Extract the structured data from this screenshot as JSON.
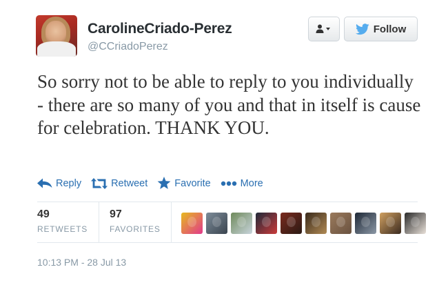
{
  "user": {
    "display_name": "CarolineCriado-Perez",
    "handle": "@CCriadoPerez"
  },
  "buttons": {
    "follow_label": "Follow"
  },
  "tweet": {
    "text": "So sorry not to be able to reply to you individually - there are so many of you and that in itself is cause for celebration. THANK YOU."
  },
  "actions": {
    "reply": "Reply",
    "retweet": "Retweet",
    "favorite": "Favorite",
    "more": "More"
  },
  "stats": {
    "retweets_count": "49",
    "retweets_label": "RETWEETS",
    "favorites_count": "97",
    "favorites_label": "FAVORITES"
  },
  "favoriters": [
    {
      "name": "favoriter-avatar-1",
      "colors": [
        "#e6b81f",
        "#e13a8c"
      ]
    },
    {
      "name": "favoriter-avatar-2",
      "colors": [
        "#7c8b98",
        "#3b4550"
      ]
    },
    {
      "name": "favoriter-avatar-3",
      "colors": [
        "#6f8a5b",
        "#c8d4dc"
      ]
    },
    {
      "name": "favoriter-avatar-4",
      "colors": [
        "#1f2a3a",
        "#c93a3a"
      ]
    },
    {
      "name": "favoriter-avatar-5",
      "colors": [
        "#7a2a1e",
        "#2b1a14"
      ]
    },
    {
      "name": "favoriter-avatar-6",
      "colors": [
        "#3a2a1c",
        "#b08a54"
      ]
    },
    {
      "name": "favoriter-avatar-7",
      "colors": [
        "#9a7a5c",
        "#6a5240"
      ]
    },
    {
      "name": "favoriter-avatar-8",
      "colors": [
        "#1e2836",
        "#8c98a6"
      ]
    },
    {
      "name": "favoriter-avatar-9",
      "colors": [
        "#d0a060",
        "#3a2a20"
      ]
    },
    {
      "name": "favoriter-avatar-10",
      "colors": [
        "#2a2a2a",
        "#e8e0d8"
      ]
    }
  ],
  "timestamp": "10:13 PM - 28 Jul 13",
  "colors": {
    "link_blue": "#2a6fb1",
    "twitter_blue": "#55acee",
    "muted": "#8899a6"
  }
}
